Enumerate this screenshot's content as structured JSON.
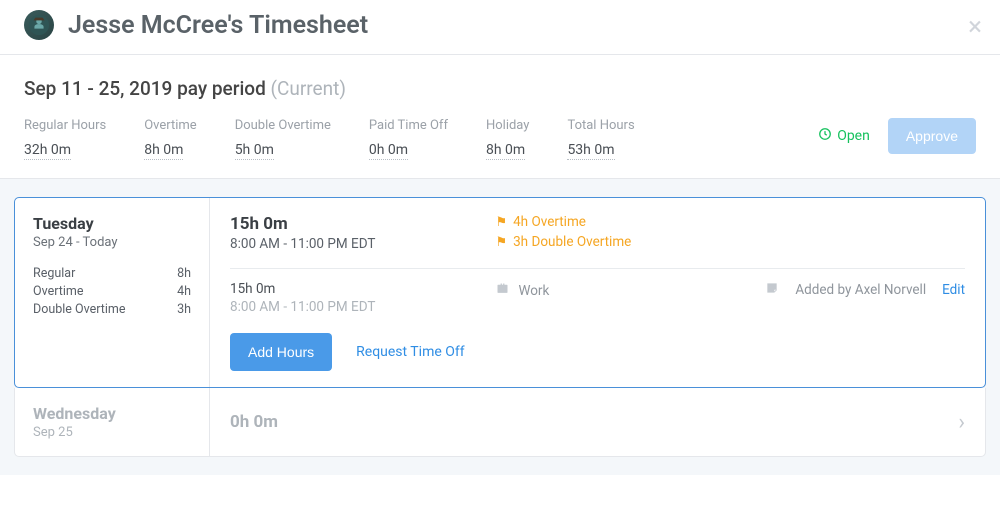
{
  "header": {
    "title": "Jesse McCree's Timesheet"
  },
  "summary": {
    "pay_period_text": "Sep 11 - 25, 2019 pay period",
    "current_label": "(Current)",
    "stats": {
      "regular": {
        "label": "Regular Hours",
        "value": "32h 0m"
      },
      "overtime": {
        "label": "Overtime",
        "value": "8h 0m"
      },
      "double_overtime": {
        "label": "Double Overtime",
        "value": "5h 0m"
      },
      "pto": {
        "label": "Paid Time Off",
        "value": "0h 0m"
      },
      "holiday": {
        "label": "Holiday",
        "value": "8h 0m"
      },
      "total": {
        "label": "Total Hours",
        "value": "53h 0m"
      }
    },
    "status_label": "Open",
    "approve_label": "Approve"
  },
  "day1": {
    "name": "Tuesday",
    "date": "Sep 24 - Today",
    "breakdown": {
      "regular": {
        "label": "Regular",
        "value": "8h"
      },
      "overtime": {
        "label": "Overtime",
        "value": "4h"
      },
      "double_overtime": {
        "label": "Double Overtime",
        "value": "3h"
      }
    },
    "total_hours": "15h 0m",
    "time_range": "8:00 AM - 11:00 PM EDT",
    "flags": {
      "overtime": "4h Overtime",
      "double_overtime": "3h Double Overtime"
    },
    "entry": {
      "hours": "15h 0m",
      "time_range": "8:00 AM - 11:00 PM EDT",
      "work_label": "Work",
      "added_by": "Added by Axel Norvell",
      "edit_label": "Edit"
    },
    "add_hours_label": "Add Hours",
    "request_label": "Request Time Off"
  },
  "day2": {
    "name": "Wednesday",
    "date": "Sep 25",
    "total_hours": "0h 0m"
  }
}
